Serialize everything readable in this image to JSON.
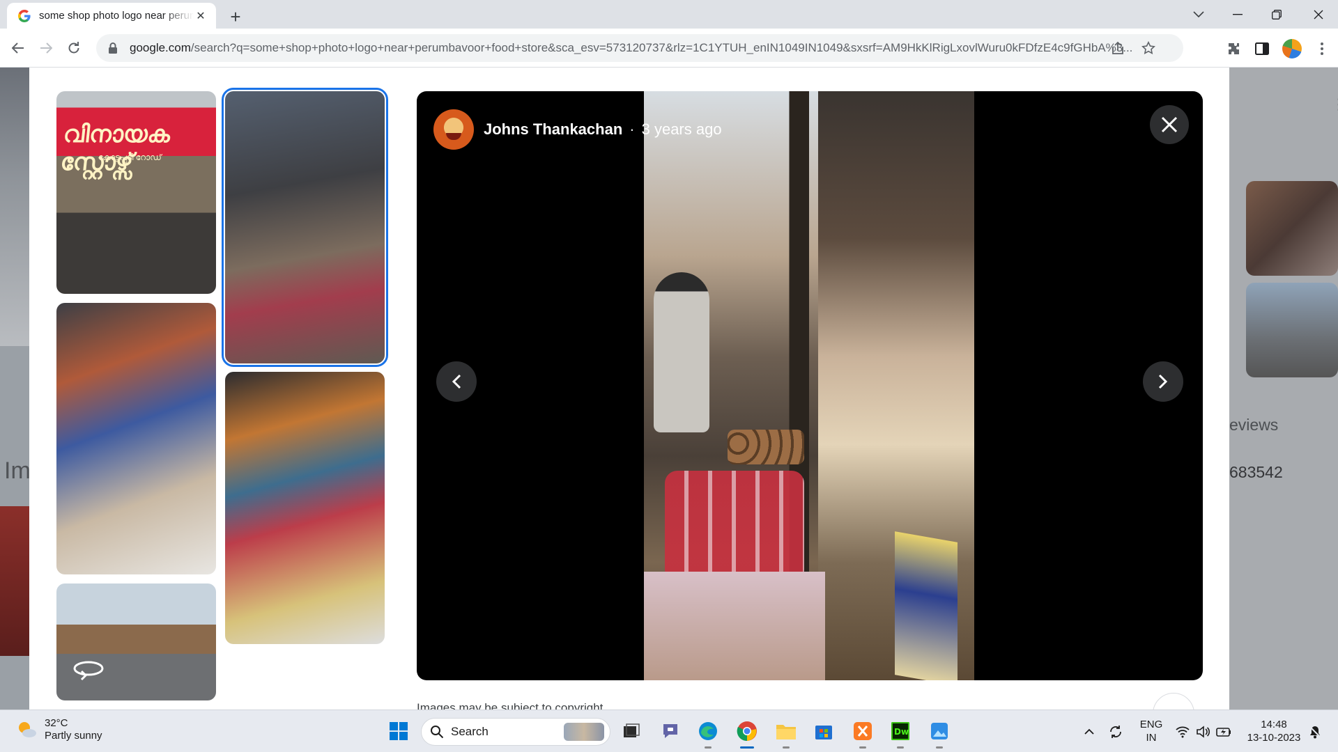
{
  "browser": {
    "tab": {
      "title": "some shop photo logo near perumbavoor food store"
    },
    "omnibox": {
      "host": "google.com",
      "path": "/search?q=some+shop+photo+logo+near+perumbavoor+food+store&sca_esv=573120737&rlz=1C1YTUH_enIN1049IN1049&sxsrf=AM9HkKlRigLxovlWuru0kFDfzE4c9fGHbA%3..."
    }
  },
  "background": {
    "left_text": "Im",
    "right_reviews": "eviews",
    "right_pin": "683542"
  },
  "viewer": {
    "author": {
      "name": "Johns Thankachan",
      "separator": "·",
      "posted": "3 years ago"
    },
    "thumbnails": [
      {
        "sign_text": "വിനായക സ്റ്റോഴ്സ്",
        "sign_subtext": "കോട്ടപ്പടി റോഡ്"
      },
      {
        "selected": true
      },
      {},
      {},
      {
        "icon": "360-rotate-icon"
      }
    ],
    "copyright": "Images may be subject to copyright"
  },
  "taskbar": {
    "weather": {
      "temp": "32°C",
      "condition": "Partly sunny"
    },
    "search": {
      "label": "Search"
    },
    "apps": [
      "windows-start-icon",
      "task-view-icon",
      "teams-chat-icon",
      "edge-icon",
      "chrome-icon",
      "file-explorer-icon",
      "microsoft-store-icon",
      "xampp-icon",
      "dreamweaver-icon",
      "photos-icon"
    ],
    "language": {
      "line1": "ENG",
      "line2": "IN"
    },
    "clock": {
      "time": "14:48",
      "date": "13-10-2023"
    }
  },
  "colors": {
    "accent": "#1a73e8",
    "tabstrip": "#dee1e6",
    "viewer_stage": "#000000",
    "taskbar_bg": "#e7eaf0"
  }
}
